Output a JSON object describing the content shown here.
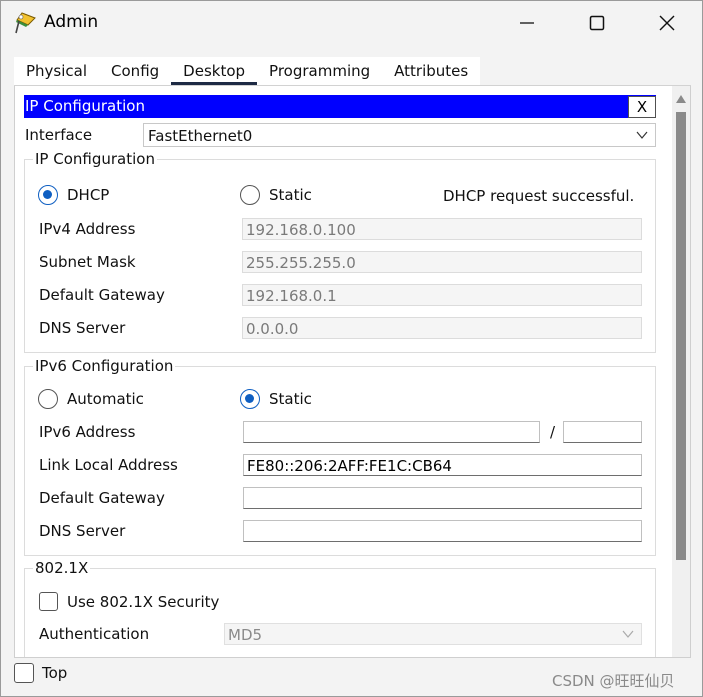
{
  "window": {
    "title": "Admin"
  },
  "tabs": [
    "Physical",
    "Config",
    "Desktop",
    "Programming",
    "Attributes"
  ],
  "active_tab": "Desktop",
  "panel": {
    "header_title": "IP Configuration",
    "close_label": "X",
    "interface_label": "Interface",
    "interface_value": "FastEthernet0"
  },
  "ipv4": {
    "group_title": "IP Configuration",
    "dhcp_label": "DHCP",
    "static_label": "Static",
    "mode": "DHCP",
    "status": "DHCP request successful.",
    "fields": [
      {
        "label": "IPv4 Address",
        "value": "192.168.0.100"
      },
      {
        "label": "Subnet Mask",
        "value": "255.255.255.0"
      },
      {
        "label": "Default Gateway",
        "value": "192.168.0.1"
      },
      {
        "label": "DNS Server",
        "value": "0.0.0.0"
      }
    ]
  },
  "ipv6": {
    "group_title": "IPv6 Configuration",
    "automatic_label": "Automatic",
    "static_label": "Static",
    "mode": "Static",
    "address_label": "IPv6 Address",
    "address_value": "",
    "prefix_separator": "/",
    "prefix_value": "",
    "link_local_label": "Link Local Address",
    "link_local_value": "FE80::206:2AFF:FE1C:CB64",
    "gateway_label": "Default Gateway",
    "gateway_value": "",
    "dns_label": "DNS Server",
    "dns_value": ""
  },
  "dot1x": {
    "group_title": "802.1X",
    "use_security_label": "Use 802.1X Security",
    "use_security_checked": false,
    "auth_label": "Authentication",
    "auth_value": "MD5"
  },
  "footer": {
    "top_label": "Top",
    "top_checked": false
  },
  "watermark": "CSDN @旺旺仙贝",
  "colors": {
    "header_blue": "#0000ff",
    "radio_blue": "#0f5fc2",
    "tab_underline": "#1d2a44"
  }
}
